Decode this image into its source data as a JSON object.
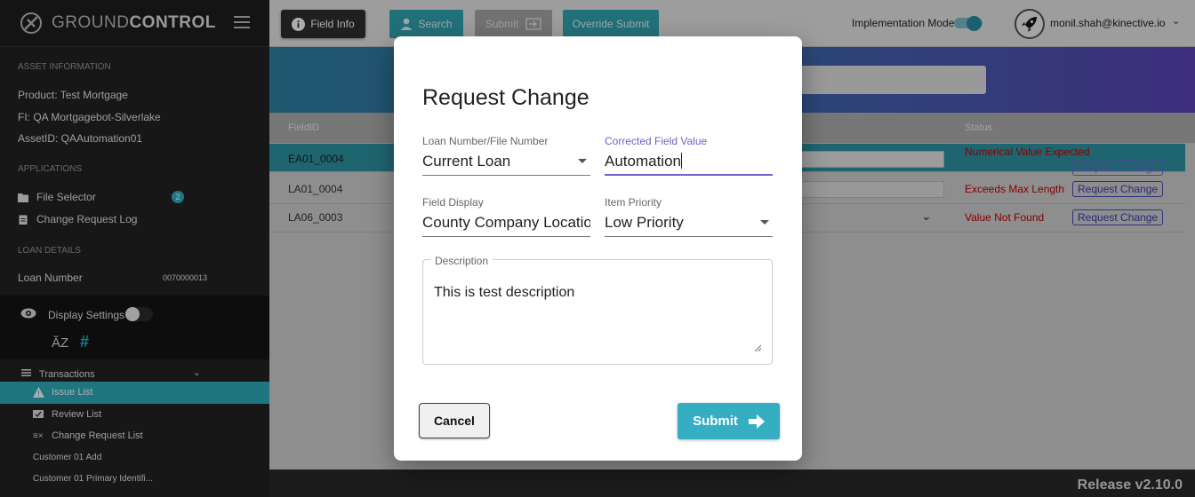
{
  "app": {
    "logo_light": "GROUND",
    "logo_bold": "CONTROL",
    "release": "Release v2.10.0"
  },
  "sidebar": {
    "asset_title": "ASSET INFORMATION",
    "product": "Product:  Test Mortgage",
    "fi": "FI:  QA Mortgagebot-Silverlake",
    "asset_id": "AssetID:  QAAutomation01",
    "applications_title": "APPLICATIONS",
    "file_selector": "File Selector",
    "file_selector_badge": "2",
    "change_request_log": "Change Request Log",
    "loan_details_title": "LOAN DETAILS",
    "loan_number_label": "Loan Number",
    "loan_number_value": "0070000013",
    "display_settings": "Display Settings",
    "transactions": "Transactions",
    "issue_list": "Issue List",
    "review_list": "Review List",
    "change_request_list": "Change Request List",
    "customer_add": "Customer 01 Add",
    "customer_primary": "Customer 01 Primary Identifi..."
  },
  "toolbar": {
    "field_info": "Field Info",
    "search": "Search",
    "submit": "Submit",
    "override_submit": "Override Submit",
    "implementation_mode": "Implementation Mode",
    "user": "monil.shah@kinective.io"
  },
  "table": {
    "col_field_id": "FieldID",
    "col_status": "Status",
    "rows": [
      {
        "id": "EA01_0004",
        "status": "Numerical Value Expected",
        "action": "Request Change"
      },
      {
        "id": "LA01_0004",
        "status": "Exceeds Max Length",
        "action": "Request Change"
      },
      {
        "id": "LA06_0003",
        "status": "Value Not Found",
        "action": "Request Change"
      }
    ]
  },
  "modal": {
    "title": "Request Change",
    "loan_label": "Loan Number/File Number",
    "loan_value": "Current Loan",
    "corrected_label": "Corrected Field Value",
    "corrected_value": "Automation",
    "display_label": "Field Display",
    "display_value": "County Company Location",
    "priority_label": "Item Priority",
    "priority_value": "Low Priority",
    "description_label": "Description",
    "description_value": "This is test description",
    "cancel": "Cancel",
    "submit": "Submit"
  },
  "colors": {
    "accent": "#35aec4",
    "focus": "#6a63c9",
    "error": "#c40000"
  }
}
